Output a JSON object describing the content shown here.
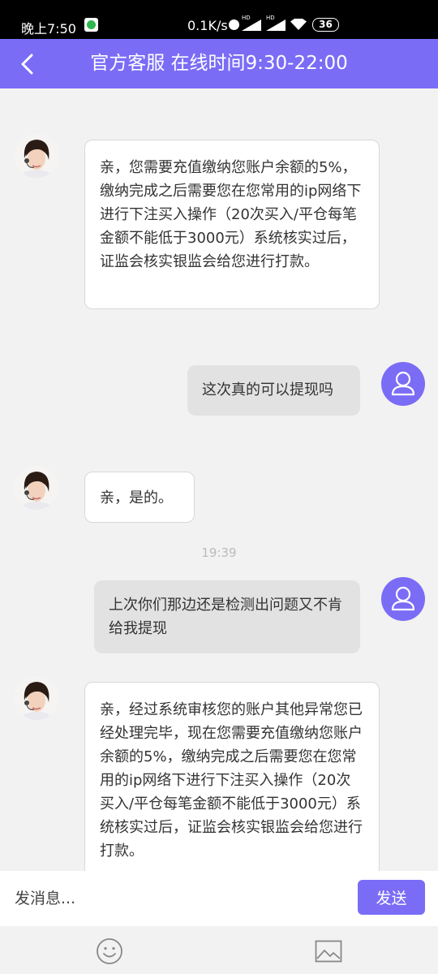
{
  "status_bar": {
    "time": "晚上7:50",
    "net_speed": "0.1K/s",
    "hd1": "HD",
    "hd2": "HD",
    "battery": "36"
  },
  "header": {
    "title": "官方客服 在线时间9:30-22:00"
  },
  "messages": [
    {
      "sender": "agent",
      "text": "亲，您需要充值缴纳您账户余额的5%，缴纳完成之后需要您在您常用的ip网络下进行下注买入操作（20次买入/平仓每笔金额不能低于3000元）系统核实过后，证监会核实银监会给您进行打款。"
    },
    {
      "sender": "user",
      "text": "这次真的可以提现吗"
    },
    {
      "sender": "agent",
      "text": "亲，是的。"
    },
    {
      "sender": "user",
      "text": "上次你们那边还是检测出问题又不肯给我提现"
    },
    {
      "sender": "agent",
      "text": "亲，经过系统审核您的账户其他异常您已经处理完毕，现在您需要充值缴纳您账户余额的5%，缴纳完成之后需要您在您常用的ip网络下进行下注买入操作（20次买入/平仓每笔金额不能低于3000元）系统核实过后，证监会核实银监会给您进行打款。"
    }
  ],
  "timestamp": "19:39",
  "input": {
    "placeholder": "发消息...",
    "value": ""
  },
  "send_label": "发送",
  "colors": {
    "accent": "#7b6cf6",
    "status_bar": "#000000",
    "background": "#f2f2f2",
    "user_bubble": "#e2e2e2",
    "agent_bubble": "#ffffff"
  }
}
